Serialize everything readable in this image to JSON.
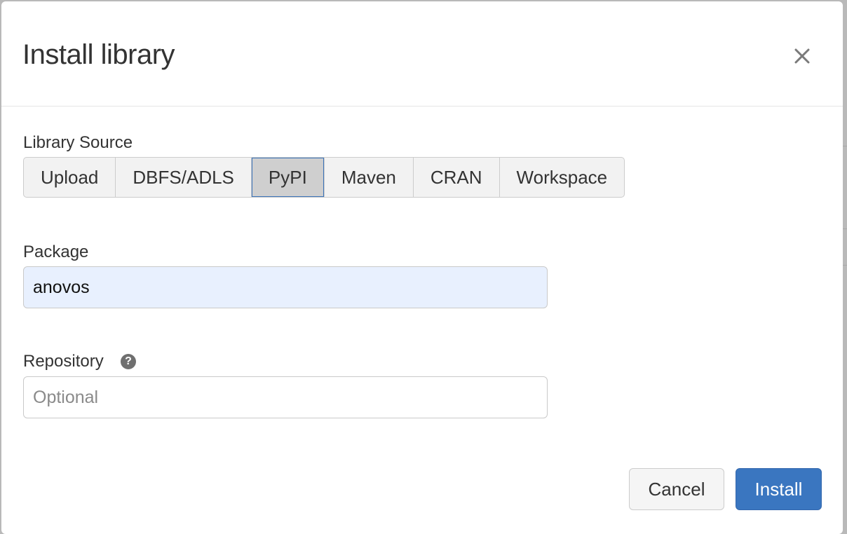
{
  "dialog": {
    "title": "Install library"
  },
  "library_source": {
    "label": "Library Source",
    "options": [
      "Upload",
      "DBFS/ADLS",
      "PyPI",
      "Maven",
      "CRAN",
      "Workspace"
    ],
    "selected": "PyPI"
  },
  "package": {
    "label": "Package",
    "value": "anovos"
  },
  "repository": {
    "label": "Repository",
    "value": "",
    "placeholder": "Optional",
    "help_icon": "question-circle-icon"
  },
  "footer": {
    "cancel_label": "Cancel",
    "install_label": "Install"
  },
  "colors": {
    "primary": "#3a76c0",
    "selected_tab_bg": "#cfcfcf",
    "autofill_bg": "#e8f0fe"
  }
}
